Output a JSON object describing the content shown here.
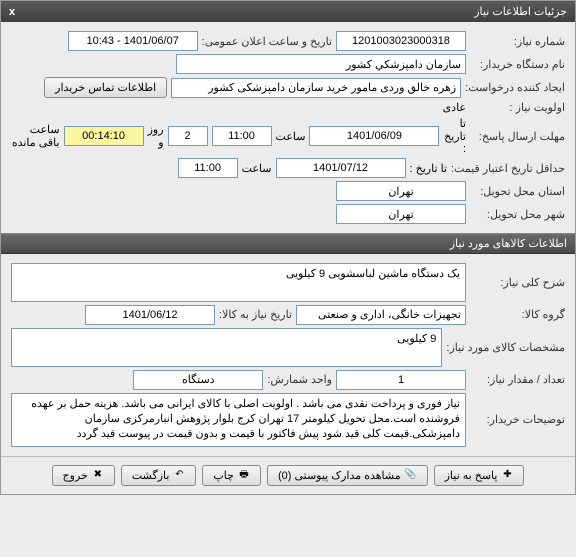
{
  "window": {
    "title": "جزئیات اطلاعات نیاز",
    "close": "x"
  },
  "sections": {
    "needInfo": {
      "needNumber": {
        "label": "شماره نیاز:",
        "value": "1201003023000318"
      },
      "publicDate": {
        "label": "تاریخ و ساعت اعلان عمومی:",
        "value": "1401/06/07 - 10:43"
      },
      "buyerOrg": {
        "label": "نام دستگاه خریدار:",
        "value": "سازمان دامپزشكي كشور"
      },
      "creator": {
        "label": "ایجاد کننده درخواست:",
        "value": "زهره خالق وردی مامور خرید سازمان دامپزشکی کشور"
      },
      "contactBtn": "اطلاعات تماس خریدار",
      "priority": {
        "label": "اولویت نیاز :",
        "value": "عادی"
      },
      "deadline": {
        "label": "مهلت ارسال پاسخ:",
        "toDateLabel": "تا تاریخ :",
        "date": "1401/06/09",
        "timeLabel": "ساعت",
        "time": "11:00",
        "remainDays": "2",
        "daysLabel": "روز و",
        "remainTime": "00:14:10",
        "remainLabel": "ساعت باقی مانده"
      },
      "validity": {
        "label": "حداقل تاریخ اعتبار قیمت:",
        "toDateLabel": "تا تاریخ :",
        "date": "1401/07/12",
        "timeLabel": "ساعت",
        "time": "11:00"
      },
      "province": {
        "label": "استان محل تحویل:",
        "value": "تهران"
      },
      "city": {
        "label": "شهر محل تحویل:",
        "value": "تهران"
      }
    },
    "goods": {
      "header": "اطلاعات کالاهای مورد نیاز",
      "desc": {
        "label": "شرح کلی نیاز:",
        "value": "یک دستگاه ماشین لباسشویی 9 کیلویی"
      },
      "group": {
        "label": "گروه کالا:",
        "value": "تجهیزات خانگی، اداری و صنعتی"
      },
      "needByDate": {
        "label": "تاریخ نیاز به کالا:",
        "value": "1401/06/12"
      },
      "spec": {
        "label": "مشخصات کالای مورد نیاز:",
        "value": "9 کیلویی"
      },
      "qty": {
        "label": "تعداد / مقدار نیاز:",
        "value": "1"
      },
      "unit": {
        "label": "واحد شمارش:",
        "value": "دستگاه"
      },
      "buyerNotes": {
        "label": "توضیحات خریدار:",
        "value": "نیاز فوری و پرداخت نقدی می باشد . اولویت اصلی با کالای ایرانی می باشد. هزینه حمل بر عهده فروشنده است.محل تحویل کیلومتر 17 تهران کرج بلوار پژوهش انبارمرکزی سازمان دامپزشکی.قیمت کلی قید شود پیش فاکتور با قیمت و بدون قیمت در پیوست قید گردد"
      }
    }
  },
  "buttons": {
    "reply": "پاسخ به نیاز",
    "attachments": "مشاهده مدارک پیوستی (0)",
    "print": "چاپ",
    "back": "بازگشت",
    "exit": "خروج"
  },
  "icons": {
    "reply": "✚",
    "attach": "📎",
    "print": "🖶",
    "back": "↶",
    "exit": "✖"
  }
}
